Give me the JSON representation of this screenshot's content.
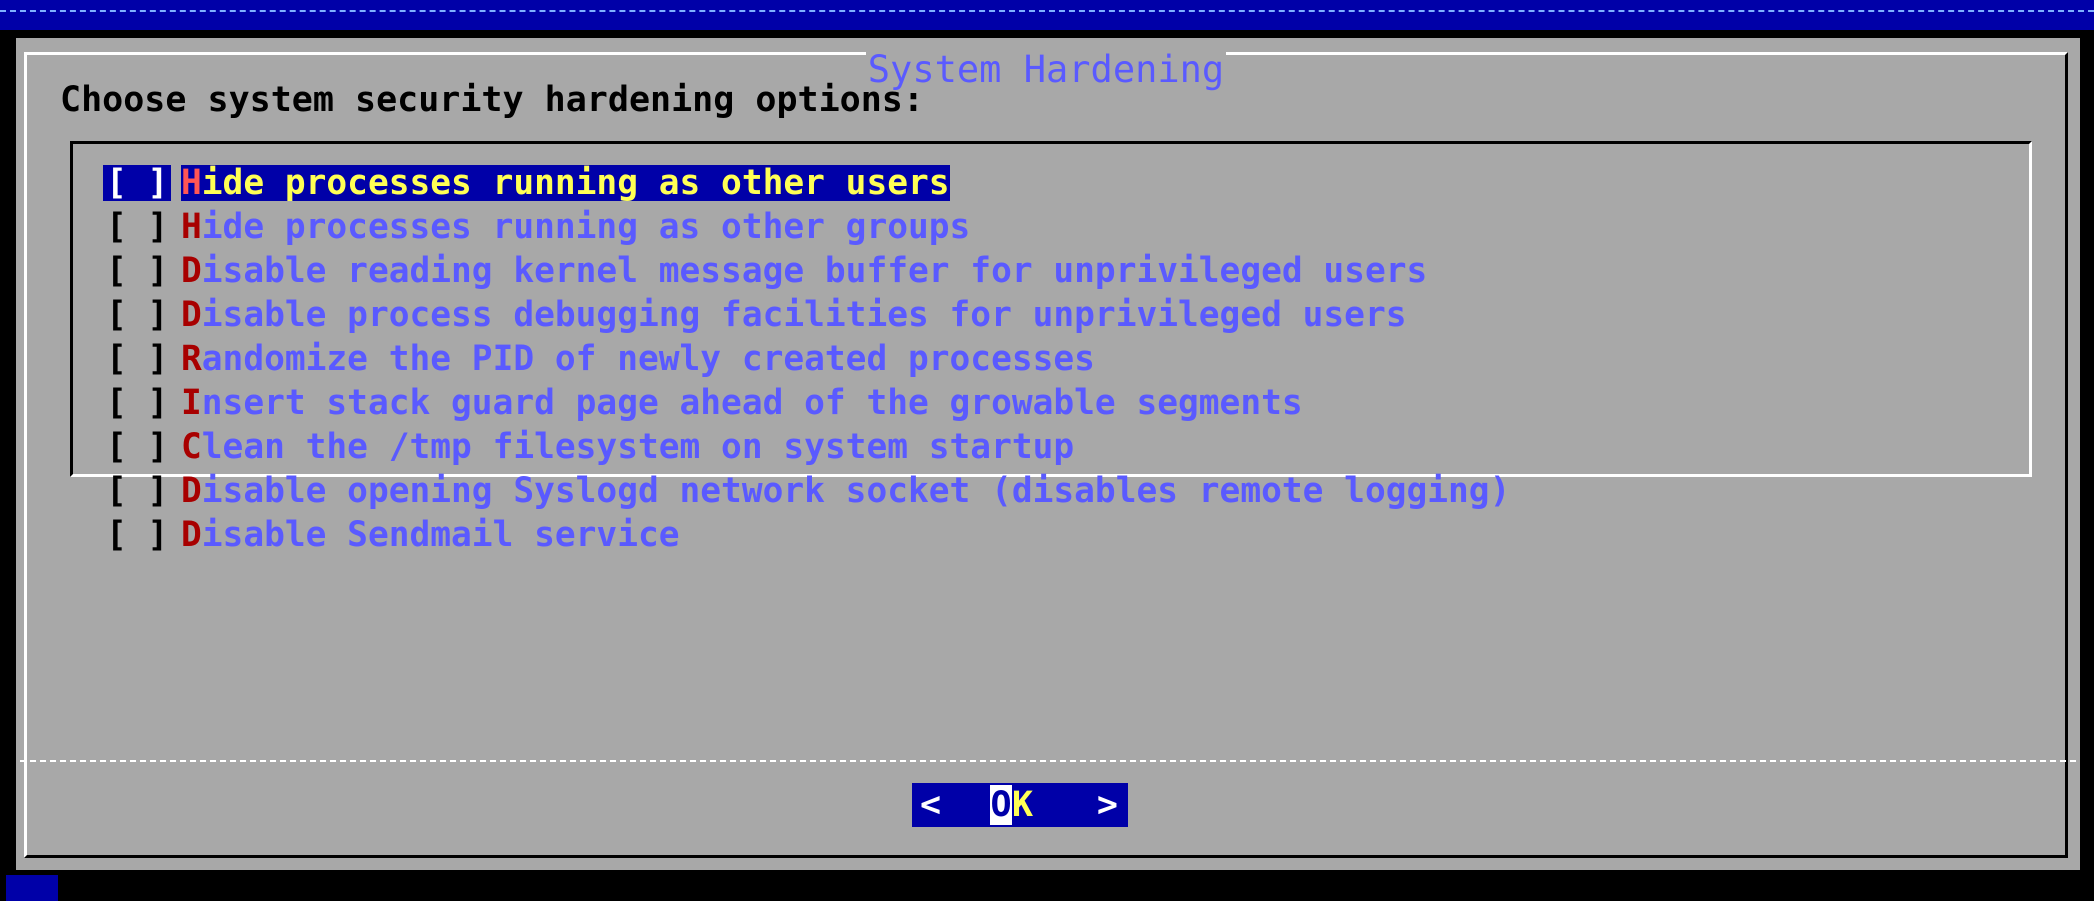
{
  "screen": {
    "background_color": "#000000",
    "top_band_color": "#0000a8"
  },
  "dialog": {
    "title": "System Hardening",
    "prompt": "Choose system security hardening options:",
    "background_color": "#a8a8a8",
    "text_color": "#5a5aff",
    "hotkey_color": "#a80000",
    "selection_color": "#0000a8"
  },
  "options": [
    {
      "checkbox": "[ ]",
      "checked": false,
      "selected": true,
      "hotkey": "H",
      "rest": "ide processes running as other users"
    },
    {
      "checkbox": "[ ]",
      "checked": false,
      "selected": false,
      "hotkey": "H",
      "rest": "ide processes running as other groups"
    },
    {
      "checkbox": "[ ]",
      "checked": false,
      "selected": false,
      "hotkey": "D",
      "rest": "isable reading kernel message buffer for unprivileged users"
    },
    {
      "checkbox": "[ ]",
      "checked": false,
      "selected": false,
      "hotkey": "D",
      "rest": "isable process debugging facilities for unprivileged users"
    },
    {
      "checkbox": "[ ]",
      "checked": false,
      "selected": false,
      "hotkey": "R",
      "rest": "andomize the PID of newly created processes"
    },
    {
      "checkbox": "[ ]",
      "checked": false,
      "selected": false,
      "hotkey": "I",
      "rest": "nsert stack guard page ahead of the growable segments"
    },
    {
      "checkbox": "[ ]",
      "checked": false,
      "selected": false,
      "hotkey": "C",
      "rest": "lean the /tmp filesystem on system startup"
    },
    {
      "checkbox": "[ ]",
      "checked": false,
      "selected": false,
      "hotkey": "D",
      "rest": "isable opening Syslogd network socket (disables remote logging)"
    },
    {
      "checkbox": "[ ]",
      "checked": false,
      "selected": false,
      "hotkey": "D",
      "rest": "isable Sendmail service"
    }
  ],
  "buttons": {
    "ok": {
      "left_bracket": "<",
      "hotkey": "O",
      "rest": "K",
      "right_bracket": ">"
    }
  }
}
